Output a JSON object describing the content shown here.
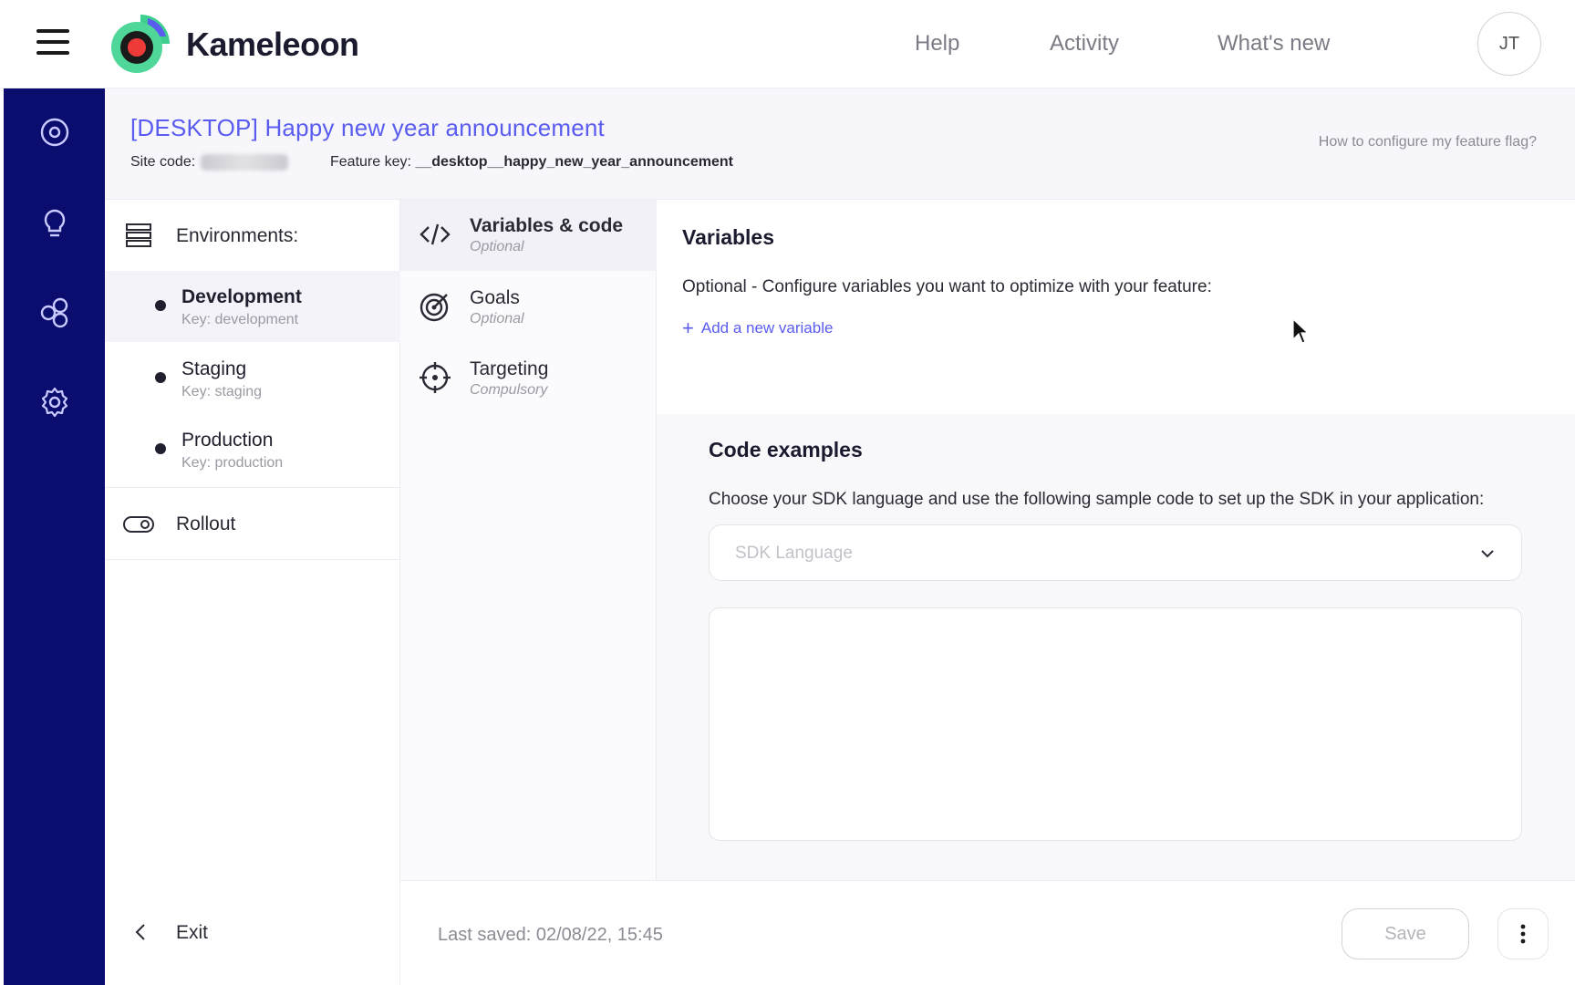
{
  "topbar": {
    "brand": "Kameleoon",
    "nav": [
      "Help",
      "Activity",
      "What's new"
    ],
    "avatar_initials": "JT"
  },
  "rail": {
    "items": [
      "dashboard-icon",
      "idea-icon",
      "flags-icon",
      "settings-icon"
    ]
  },
  "header": {
    "title": "[DESKTOP] Happy new year announcement",
    "site_code_label": "Site code:",
    "feature_key_label": "Feature key:",
    "feature_key_value": "__desktop__happy_new_year_announcement",
    "help_link": "How to configure my feature flag?"
  },
  "environments": {
    "label": "Environments:",
    "items": [
      {
        "name": "Development",
        "key": "Key: development",
        "active": true
      },
      {
        "name": "Staging",
        "key": "Key: staging",
        "active": false
      },
      {
        "name": "Production",
        "key": "Key: production",
        "active": false
      }
    ],
    "rollout_label": "Rollout",
    "exit_label": "Exit"
  },
  "steps": [
    {
      "title": "Variables & code",
      "sub": "Optional",
      "icon": "code-icon"
    },
    {
      "title": "Goals",
      "sub": "Optional",
      "icon": "target-icon"
    },
    {
      "title": "Targeting",
      "sub": "Compulsory",
      "icon": "crosshair-icon"
    }
  ],
  "variables": {
    "title": "Variables",
    "desc": "Optional - Configure variables you want to optimize with your feature:",
    "add_label": "Add a new variable"
  },
  "code_examples": {
    "title": "Code examples",
    "desc": "Choose your SDK language and use the following sample code to set up the SDK in your application:",
    "sdk_placeholder": "SDK Language"
  },
  "footer": {
    "last_saved": "Last saved: 02/08/22, 15:45",
    "save_label": "Save"
  },
  "colors": {
    "rail": "#0b0d6e",
    "accent": "#5a5cf0"
  }
}
